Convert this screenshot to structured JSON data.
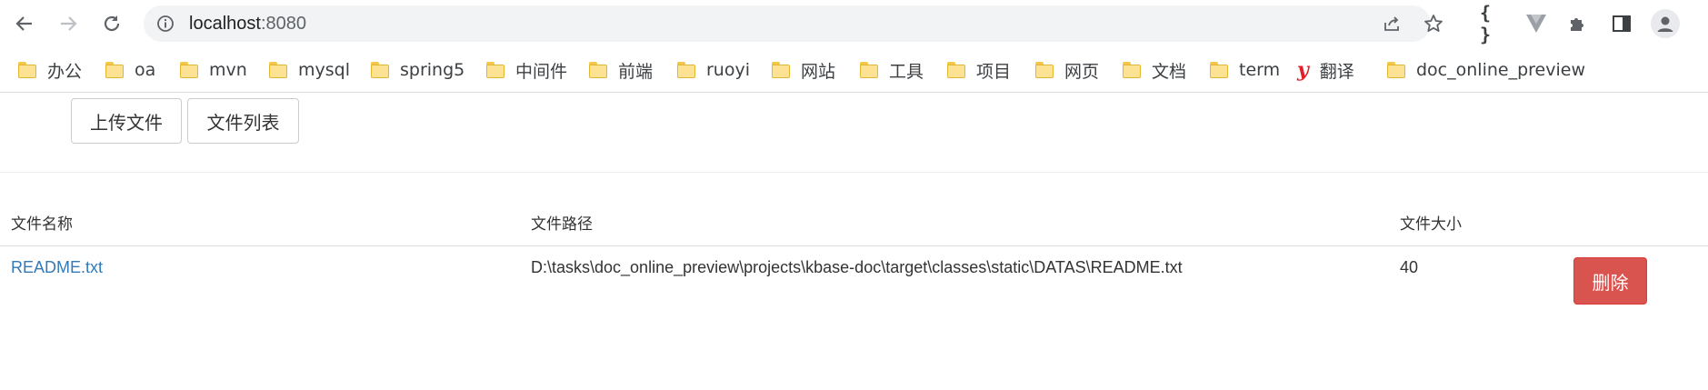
{
  "browser": {
    "url_host": "localhost",
    "url_port": ":8080",
    "bookmarks": [
      {
        "label": "办公",
        "icon": "folder-icon"
      },
      {
        "label": "oa",
        "icon": "folder-icon"
      },
      {
        "label": "mvn",
        "icon": "folder-icon"
      },
      {
        "label": "mysql",
        "icon": "folder-icon"
      },
      {
        "label": "spring5",
        "icon": "folder-icon"
      },
      {
        "label": "中间件",
        "icon": "folder-icon"
      },
      {
        "label": "前端",
        "icon": "folder-icon"
      },
      {
        "label": "ruoyi",
        "icon": "folder-icon"
      },
      {
        "label": "网站",
        "icon": "folder-icon"
      },
      {
        "label": "工具",
        "icon": "folder-icon"
      },
      {
        "label": "项目",
        "icon": "folder-icon"
      },
      {
        "label": "网页",
        "icon": "folder-icon"
      },
      {
        "label": "文档",
        "icon": "folder-icon"
      },
      {
        "label": "term",
        "icon": "folder-icon"
      },
      {
        "label": "翻译",
        "icon": "youdao-icon"
      },
      {
        "label": "doc_online_preview",
        "icon": "folder-icon"
      }
    ]
  },
  "page": {
    "upload_button": "上传文件",
    "list_button": "文件列表",
    "table": {
      "headers": [
        "文件名称",
        "文件路径",
        "文件大小"
      ],
      "rows": [
        {
          "name": "README.txt",
          "path": "D:\\tasks\\doc_online_preview\\projects\\kbase-doc\\target\\classes\\static\\DATAS\\README.txt",
          "size": "40",
          "delete_label": "删除"
        }
      ]
    }
  },
  "colors": {
    "link": "#337ab7",
    "danger": "#d9534f",
    "omnibox_bg": "#f1f3f4"
  }
}
